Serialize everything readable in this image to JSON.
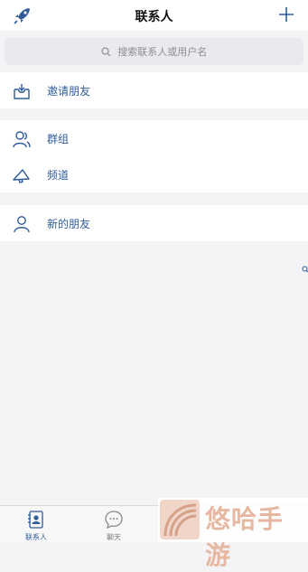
{
  "header": {
    "title": "联系人",
    "left_icon": "rocket-icon",
    "right_icon": "plus-icon"
  },
  "search": {
    "placeholder": "搜索联系人或用户名",
    "icon": "search-icon"
  },
  "sections": [
    {
      "items": [
        {
          "label": "邀请朋友",
          "icon": "invite-inbox-icon"
        }
      ]
    },
    {
      "items": [
        {
          "label": "群组",
          "icon": "group-people-icon"
        },
        {
          "label": "频道",
          "icon": "megaphone-icon"
        }
      ]
    },
    {
      "items": [
        {
          "label": "新的朋友",
          "icon": "person-icon"
        }
      ]
    }
  ],
  "tabbar": {
    "tabs": [
      {
        "label": "联系人",
        "icon": "contacts-icon",
        "active": true
      },
      {
        "label": "聊天",
        "icon": "chat-bubble-icon",
        "active": false
      }
    ]
  },
  "watermark": {
    "text": "悠哈手游",
    "icon": "watermark-logo-icon"
  },
  "colors": {
    "accent": "#2f5d9a",
    "background": "#f4f4f6",
    "search_bg": "#e9e9ee"
  }
}
